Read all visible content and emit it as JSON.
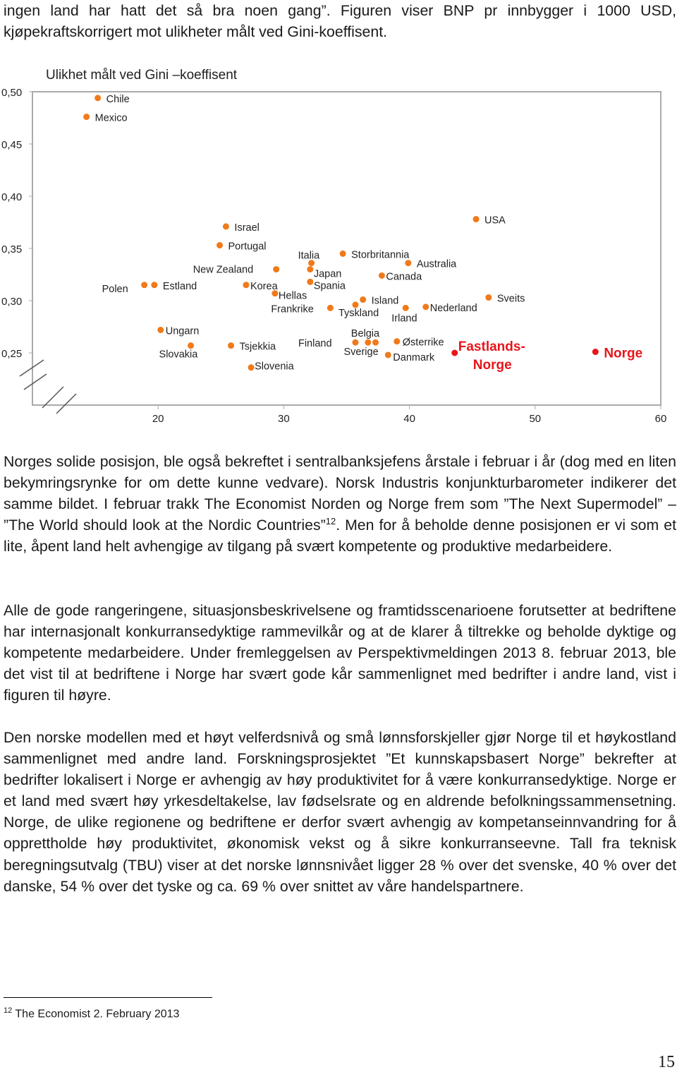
{
  "intro_text": "ingen land har hatt det så bra noen gang”. Figuren viser BNP pr innbygger i 1000 USD, kjøpekraftskorrigert mot ulikheter målt ved Gini-koeffisent.",
  "chart_data": {
    "type": "scatter",
    "title": "Ulikhet målt ved Gini –koeffisent",
    "xlabel": "",
    "ylabel": "",
    "xlim": [
      10,
      60
    ],
    "ylim": [
      0.2,
      0.5
    ],
    "x_ticks": [
      "20",
      "30",
      "40",
      "50",
      "60"
    ],
    "y_ticks": [
      "0,50",
      "0,45",
      "0,40",
      "0,35",
      "0,30",
      "0,25"
    ],
    "axis_break": true,
    "grid": false,
    "point_color": "#f07a1a",
    "highlight_color": "#e8151b",
    "points": [
      {
        "label": "Chile",
        "x": 15.2,
        "y": 0.494
      },
      {
        "label": "Mexico",
        "x": 14.3,
        "y": 0.476
      },
      {
        "label": "Israel",
        "x": 25.4,
        "y": 0.371
      },
      {
        "label": "Portugal",
        "x": 24.9,
        "y": 0.353
      },
      {
        "label": "New Zealand",
        "x": 29.4,
        "y": 0.33
      },
      {
        "label": "Polen",
        "x": 18.9,
        "y": 0.315
      },
      {
        "label": "Estland",
        "x": 19.7,
        "y": 0.315
      },
      {
        "label": "Korea",
        "x": 27.0,
        "y": 0.315
      },
      {
        "label": "Hellas",
        "x": 29.3,
        "y": 0.307
      },
      {
        "label": "Italia",
        "x": 32.2,
        "y": 0.336
      },
      {
        "label": "Japan",
        "x": 32.1,
        "y": 0.33
      },
      {
        "label": "Spania",
        "x": 32.1,
        "y": 0.318
      },
      {
        "label": "Frankrike",
        "x": 33.7,
        "y": 0.293
      },
      {
        "label": "Storbritannia",
        "x": 34.7,
        "y": 0.345
      },
      {
        "label": "Australia",
        "x": 39.9,
        "y": 0.336
      },
      {
        "label": "Canada",
        "x": 37.8,
        "y": 0.324
      },
      {
        "label": "Tyskland",
        "x": 35.7,
        "y": 0.296
      },
      {
        "label": "Island",
        "x": 36.3,
        "y": 0.301
      },
      {
        "label": "Irland",
        "x": 39.7,
        "y": 0.293
      },
      {
        "label": "Nederland",
        "x": 41.3,
        "y": 0.294
      },
      {
        "label": "USA",
        "x": 45.3,
        "y": 0.378
      },
      {
        "label": "Sveits",
        "x": 46.3,
        "y": 0.303
      },
      {
        "label": "Ungarn",
        "x": 20.2,
        "y": 0.272
      },
      {
        "label": "Slovakia",
        "x": 22.6,
        "y": 0.257
      },
      {
        "label": "Tsjekkia",
        "x": 25.8,
        "y": 0.257
      },
      {
        "label": "Slovenia",
        "x": 27.4,
        "y": 0.236
      },
      {
        "label": "Finland",
        "x": 35.7,
        "y": 0.26
      },
      {
        "label": "Belgia",
        "x": 36.7,
        "y": 0.26
      },
      {
        "label": "Sverige",
        "x": 37.3,
        "y": 0.26
      },
      {
        "label": "Østerrike",
        "x": 39.0,
        "y": 0.261
      },
      {
        "label": "Danmark",
        "x": 38.3,
        "y": 0.248
      },
      {
        "label": "Fastlands-Norge",
        "x": 43.6,
        "y": 0.25,
        "highlight": true
      },
      {
        "label": "Norge",
        "x": 54.8,
        "y": 0.251,
        "highlight": true
      }
    ]
  },
  "paragraphs": [
    {
      "before": "Norges solide posisjon, ble også bekreftet i sentralbanksjefens årstale i februar i år (dog med en liten bekymringsrynke for om dette kunne vedvare). Norsk Industris konjunkturbarometer indikerer det samme bildet. I februar trakk The Economist Norden og Norge frem som ”The Next Supermodel” – ”The World should look at the Nordic Countries”",
      "sup": "12",
      "after": ". Men for å beholde denne posisjonen er vi som et lite, åpent land helt avhengige av tilgang på svært kompetente og produktive medarbeidere."
    },
    {
      "text": "Alle de gode rangeringene, situasjonsbeskrivelsene og framtidsscenarioene forutsetter at bedriftene har internasjonalt konkurransedyktige rammevilkår og at de klarer å tiltrekke og beholde dyktige og kompetente medarbeidere. Under fremleggelsen av Perspektivmeldingen 2013 8. februar 2013, ble det vist til at bedriftene i Norge har svært gode kår sammenlignet med bedrifter i andre land, vist i figuren til høyre."
    },
    {
      "text": "Den norske modellen med et høyt velferdsnivå og små lønnsforskjeller gjør Norge til et høykostland sammenlignet med andre land. Forskningsprosjektet ”Et kunnskapsbasert Norge” bekrefter at bedrifter lokalisert i Norge er avhengig av høy produktivitet for å være konkurransedyktige.  Norge er et land med svært høy yrkesdeltakelse, lav fødselsrate og en aldrende befolkningssammensetning. Norge, de ulike regionene og bedriftene er derfor svært avhengig av kompetanseinnvandring for å opprettholde høy produktivitet, økonomisk vekst og å sikre konkurranseevne. Tall fra teknisk beregningsutvalg (TBU) viser at det norske lønnsnivået ligger 28 % over det svenske, 40 % over det danske, 54 % over det tyske og ca. 69 % over snittet av våre handelspartnere."
    }
  ],
  "footnote": {
    "number": "12",
    "text": " The Economist 2. February 2013"
  },
  "page_number": "15"
}
